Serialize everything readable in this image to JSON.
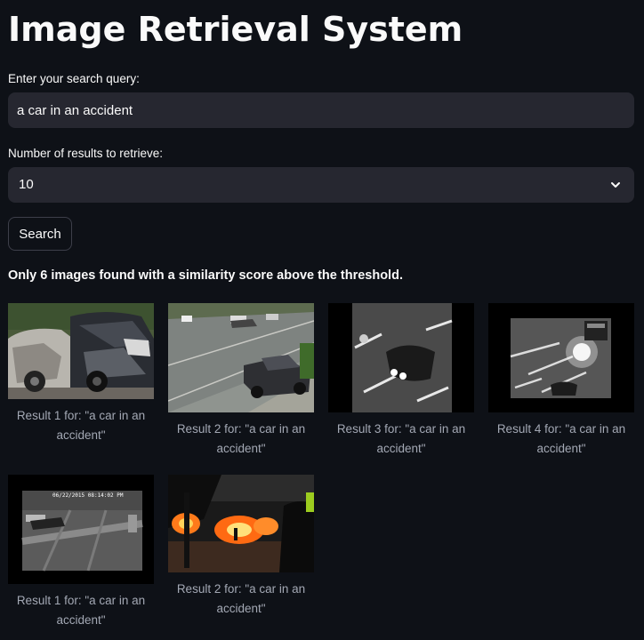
{
  "app": {
    "title": "Image Retrieval System"
  },
  "query": {
    "label": "Enter your search query:",
    "value": "a car in an accident"
  },
  "num_results": {
    "label": "Number of results to retrieve:",
    "selected": "10",
    "icon": "chevron-down-icon"
  },
  "search_button": {
    "label": "Search"
  },
  "info_text": "Only 6 images found with a similarity score above the threshold.",
  "results": [
    {
      "caption": "Result 1 for: \"a car in an accident\"",
      "image": "wrecked cars"
    },
    {
      "caption": "Result 2 for: \"a car in an accident\"",
      "image": "street intersection"
    },
    {
      "caption": "Result 3 for: \"a car in an accident\"",
      "image": "night cctv car"
    },
    {
      "caption": "Result 4 for: \"a car in an accident\"",
      "image": "night cctv street"
    },
    {
      "caption": "Result 1 for: \"a car in an accident\"",
      "image": "cctv intersection"
    },
    {
      "caption": "Result 2 for: \"a car in an accident\"",
      "image": "street fire"
    }
  ],
  "cctv_timestamp": "06/22/2015 08:14:02 PM",
  "colors": {
    "background": "#0e1117",
    "input_bg": "#262730",
    "text": "#fafafa",
    "caption": "#a3a8b4"
  }
}
